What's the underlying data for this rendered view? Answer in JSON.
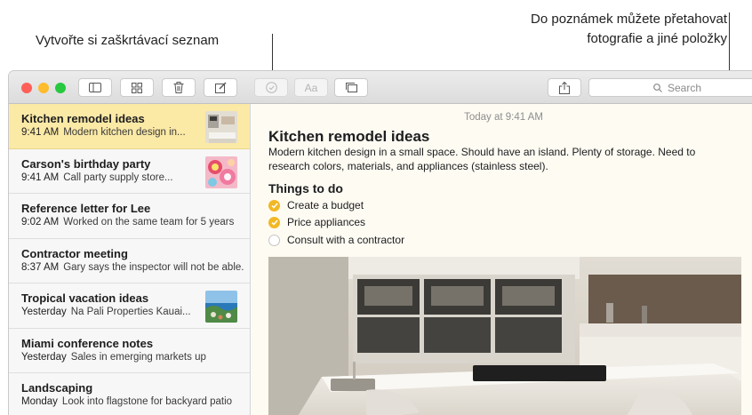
{
  "callouts": {
    "checklist": "Vytvořte si zaškrtávací seznam",
    "drag_line1": "Do poznámek můžete přetahovat",
    "drag_line2": "fotografie a jiné položky"
  },
  "colors": {
    "close": "#fe5f57",
    "minimize": "#febc2e",
    "zoom": "#28c840",
    "selected_note": "#fbe9a6",
    "check_done": "#f2b824"
  },
  "toolbar": {
    "buttons": [
      "sidebar-icon",
      "gallery-icon",
      "trash-icon",
      "compose-icon",
      "checklist-icon",
      "format-icon",
      "table-icon",
      "share-icon"
    ],
    "format_label": "Aa",
    "search_placeholder": "Search"
  },
  "notes": [
    {
      "title": "Kitchen remodel ideas",
      "time": "9:41 AM",
      "preview": "Modern kitchen design in...",
      "thumb": "kitchen",
      "selected": true
    },
    {
      "title": "Carson's birthday party",
      "time": "9:41 AM",
      "preview": "Call party supply store...",
      "thumb": "party"
    },
    {
      "title": "Reference letter for Lee",
      "time": "9:02 AM",
      "preview": "Worked on the same team for 5 years"
    },
    {
      "title": "Contractor meeting",
      "time": "8:37 AM",
      "preview": "Gary says the inspector will not be able..."
    },
    {
      "title": "Tropical vacation ideas",
      "time": "Yesterday",
      "preview": "Na Pali Properties Kauai...",
      "thumb": "tropical"
    },
    {
      "title": "Miami conference notes",
      "time": "Yesterday",
      "preview": "Sales in emerging markets up"
    },
    {
      "title": "Landscaping",
      "time": "Monday",
      "preview": "Look into flagstone for backyard patio"
    }
  ],
  "document": {
    "date": "Today at 9:41 AM",
    "title": "Kitchen remodel ideas",
    "body": "Modern kitchen design in a small space. Should have an island. Plenty of storage. Need to research colors, materials, and appliances (stainless steel).",
    "checklist_heading": "Things to do",
    "checklist": [
      {
        "label": "Create a budget",
        "done": true
      },
      {
        "label": "Price appliances",
        "done": true
      },
      {
        "label": "Consult with a contractor",
        "done": false
      }
    ]
  }
}
